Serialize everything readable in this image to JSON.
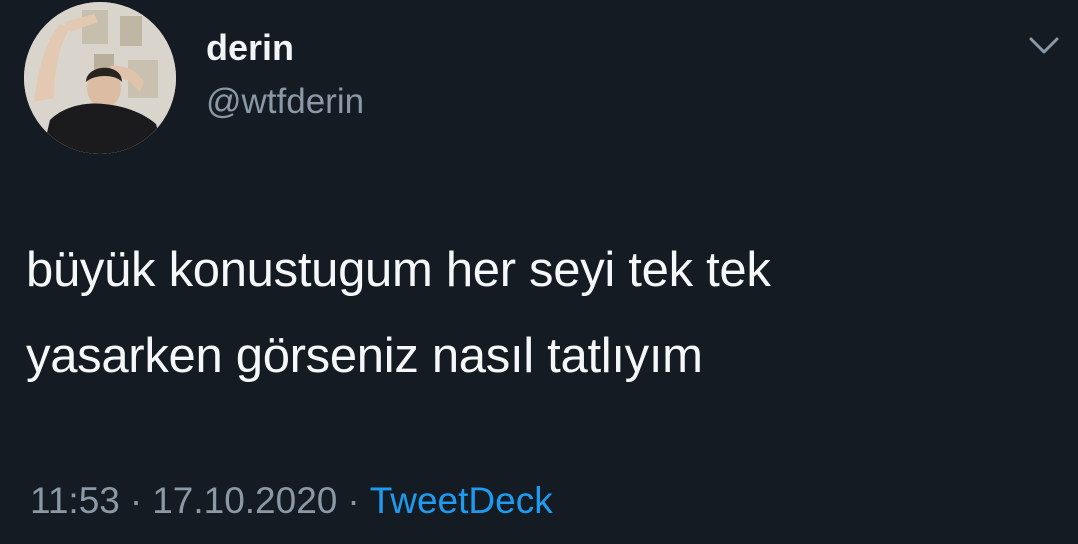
{
  "author": {
    "display_name": "derin",
    "handle": "@wtfderin"
  },
  "tweet": {
    "lines": [
      "büyük konustugum her seyi tek tek",
      "yasarken görseniz nasıl tatlıyım"
    ],
    "time": "11:53",
    "separator": "·",
    "date": "17.10.2020",
    "source": "TweetDeck"
  },
  "icons": {
    "menu": "chevron-down-icon"
  },
  "colors": {
    "background": "#151b23",
    "text": "#f5f7f9",
    "muted": "#8b98a5",
    "link": "#1d9bf0"
  }
}
